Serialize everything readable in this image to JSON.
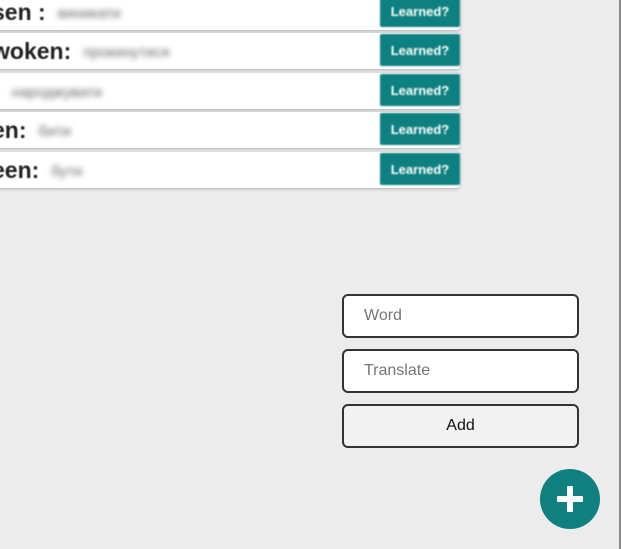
{
  "word_list": {
    "rows": [
      {
        "word": "sen :",
        "translation": "виникати",
        "learned_label": "Learned?"
      },
      {
        "word": "woken:",
        "translation": "прокинутися",
        "learned_label": "Learned?"
      },
      {
        "word": ":",
        "translation": "народжувати",
        "learned_label": "Learned?"
      },
      {
        "word": "en:",
        "translation": "бити",
        "learned_label": "Learned?"
      },
      {
        "word": "een:",
        "translation": "бути",
        "learned_label": "Learned?"
      }
    ]
  },
  "add_form": {
    "word_placeholder": "Word",
    "translate_placeholder": "Translate",
    "add_label": "Add"
  },
  "fab": {
    "icon": "plus-icon"
  },
  "colors": {
    "accent": "#0e8080",
    "background": "#ececec"
  }
}
